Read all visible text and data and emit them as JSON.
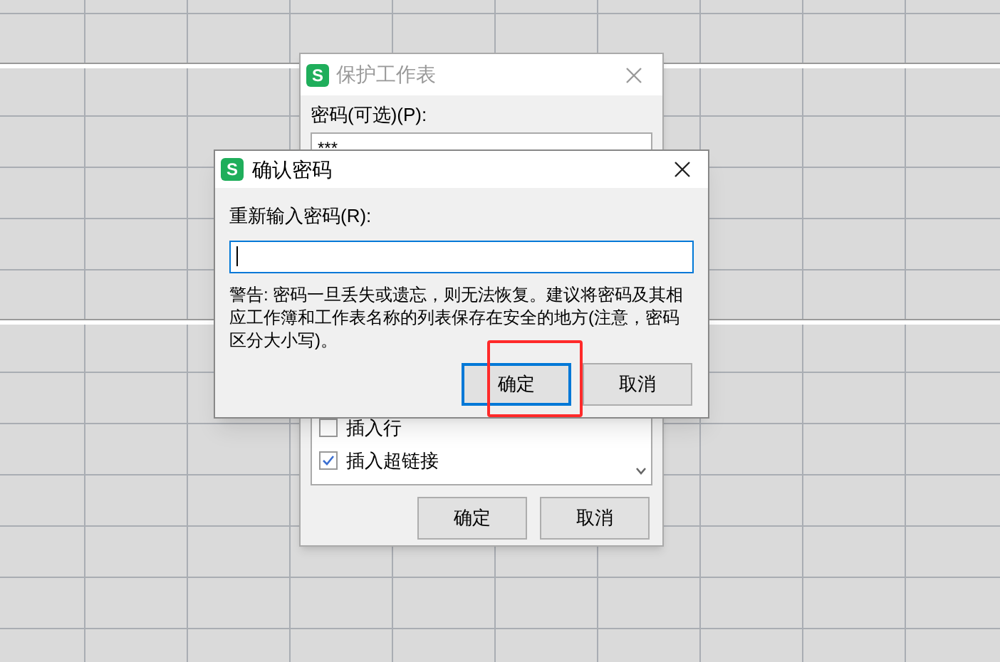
{
  "back_dialog": {
    "logo": "S",
    "title": "保护工作表",
    "password_label": "密码(可选)(P):",
    "password_value": "***",
    "permissions": [
      {
        "label": "插入行",
        "checked": false
      },
      {
        "label": "插入超链接",
        "checked": true
      }
    ],
    "buttons": [
      {
        "label": "确定",
        "focused": false
      },
      {
        "label": "取消",
        "focused": false
      }
    ]
  },
  "confirm_dialog": {
    "logo": "S",
    "title": "确认密码",
    "reenter_label": "重新输入密码(R):",
    "warning": "警告: 密码一旦丢失或遗忘，则无法恢复。建议将密码及其相应工作簿和工作表名称的列表保存在安全的地方(注意，密码区分大小写)。",
    "buttons": [
      {
        "label": "确定",
        "focused": true,
        "highlighted": true
      },
      {
        "label": "取消",
        "focused": false,
        "highlighted": false
      }
    ]
  }
}
